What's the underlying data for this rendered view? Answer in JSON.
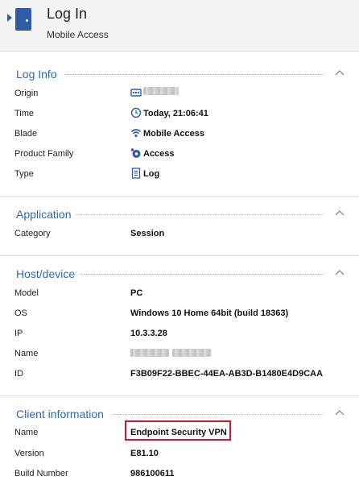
{
  "header": {
    "title": "Log In",
    "subtitle": "Mobile Access",
    "icon": "door-icon",
    "accent": "#2e5da8"
  },
  "sections": [
    {
      "title": "Log Info",
      "rows": [
        {
          "label": "Origin",
          "value": "",
          "icon": "gateway-icon",
          "redacted": true
        },
        {
          "label": "Time",
          "value": "Today, 21:06:41",
          "icon": "clock-icon"
        },
        {
          "label": "Blade",
          "value": "Mobile Access",
          "icon": "wifi-icon"
        },
        {
          "label": "Product Family",
          "value": "Access",
          "icon": "access-icon"
        },
        {
          "label": "Type",
          "value": "Log",
          "icon": "document-icon"
        }
      ]
    },
    {
      "title": "Application",
      "rows": [
        {
          "label": "Category",
          "value": "Session"
        }
      ]
    },
    {
      "title": "Host/device",
      "rows": [
        {
          "label": "Model",
          "value": "PC"
        },
        {
          "label": "OS",
          "value": "Windows 10 Home 64bit (build 18363)"
        },
        {
          "label": "IP",
          "value": "10.3.3.28"
        },
        {
          "label": "Name",
          "value": "",
          "redacted": true
        },
        {
          "label": "ID",
          "value": "F3B09F22-BBEC-44EA-AB3D-B1480E4D9CAA"
        }
      ]
    },
    {
      "title": "Client information",
      "rows": [
        {
          "label": "Name",
          "value": "Endpoint Security VPN",
          "highlighted": true
        },
        {
          "label": "Version",
          "value": "E81.10"
        },
        {
          "label": "Build Number",
          "value": "986100611"
        }
      ]
    }
  ],
  "colors": {
    "section_title": "#2e6ab3",
    "highlight_border": "#d0162a",
    "header_bg": "#f4f4f4"
  }
}
